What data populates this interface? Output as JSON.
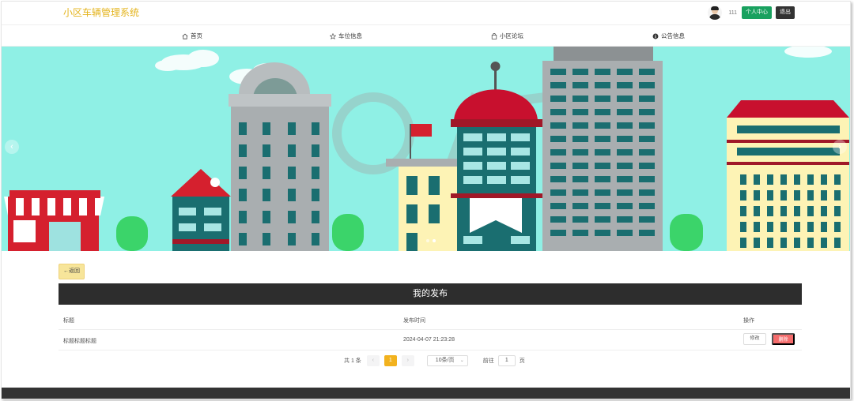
{
  "app": {
    "title": "小区车辆管理系统"
  },
  "user": {
    "name": "111",
    "center_label": "个人中心",
    "logout_label": "退出"
  },
  "nav": [
    {
      "label": "首页",
      "icon": "home-icon"
    },
    {
      "label": "车位信息",
      "icon": "star-icon"
    },
    {
      "label": "小区论坛",
      "icon": "bag-icon"
    },
    {
      "label": "公告信息",
      "icon": "info-icon"
    }
  ],
  "banner": {
    "arrow_left": "‹",
    "arrow_right": "›"
  },
  "page": {
    "back_label": "←返回",
    "title": "我的发布"
  },
  "table": {
    "headers": [
      "标题",
      "发布时间",
      "操作"
    ],
    "rows": [
      {
        "title": "标题标题标题",
        "time": "2024-04-07 21:23:28",
        "edit_label": "修改",
        "delete_label": "删除"
      }
    ]
  },
  "pagination": {
    "total": "共 1 条",
    "prev": "‹",
    "current": "1",
    "next": "›",
    "page_size": "10条/页",
    "goto_prefix": "前往",
    "goto_value": "1",
    "goto_suffix": "页"
  },
  "colors": {
    "brand": "#e4b41e",
    "primary": "#19a15f",
    "dark": "#2d2d2d",
    "danger": "#f56c6c",
    "accent": "#f2b21e",
    "sky": "#8ff0e5"
  }
}
